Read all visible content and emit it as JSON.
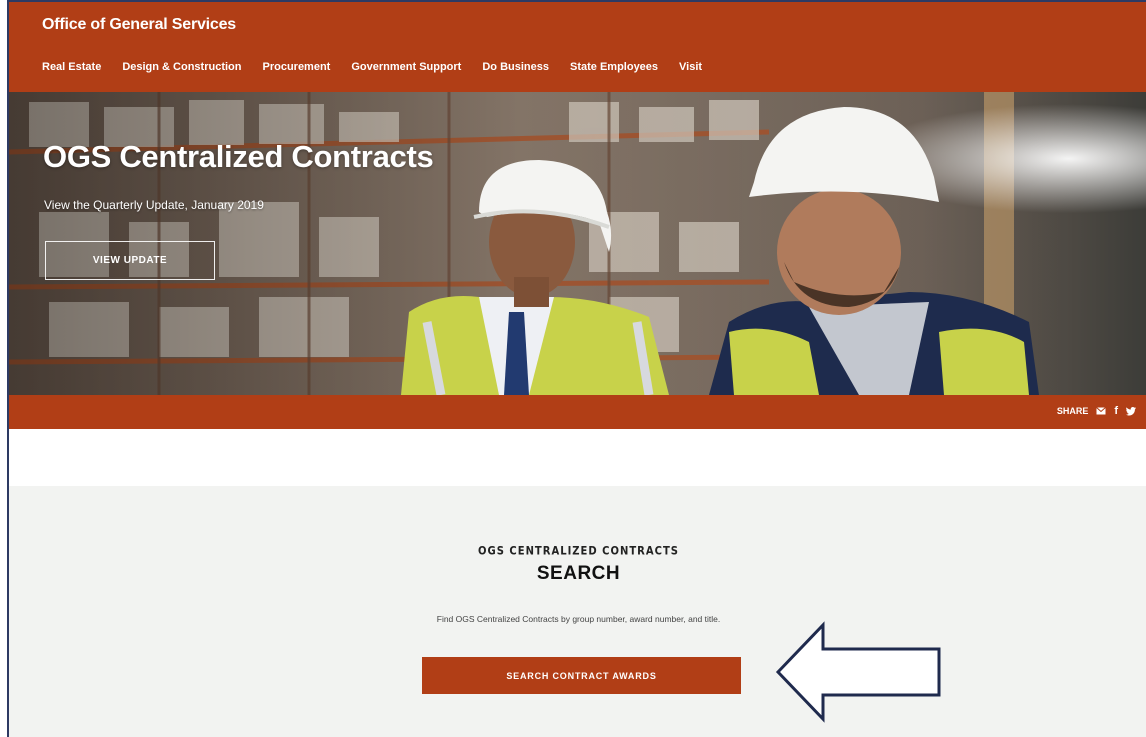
{
  "header": {
    "site_title": "Office of General Services",
    "nav": [
      "Real Estate",
      "Design & Construction",
      "Procurement",
      "Government Support",
      "Do Business",
      "State Employees",
      "Visit"
    ]
  },
  "hero": {
    "title": "OGS Centralized Contracts",
    "subtitle": "View the Quarterly Update, January 2019",
    "button_label": "VIEW UPDATE"
  },
  "share": {
    "label": "SHARE",
    "icons": [
      "email-icon",
      "facebook-icon",
      "twitter-icon"
    ]
  },
  "search": {
    "eyebrow": "OGS CENTRALIZED CONTRACTS",
    "heading": "SEARCH",
    "description": "Find OGS Centralized Contracts by group number, award number, and title.",
    "button_label": "SEARCH CONTRACT AWARDS"
  },
  "colors": {
    "brand": "#b13e16",
    "section_bg": "#f2f3f1",
    "arrow_stroke": "#1f2a4d"
  }
}
